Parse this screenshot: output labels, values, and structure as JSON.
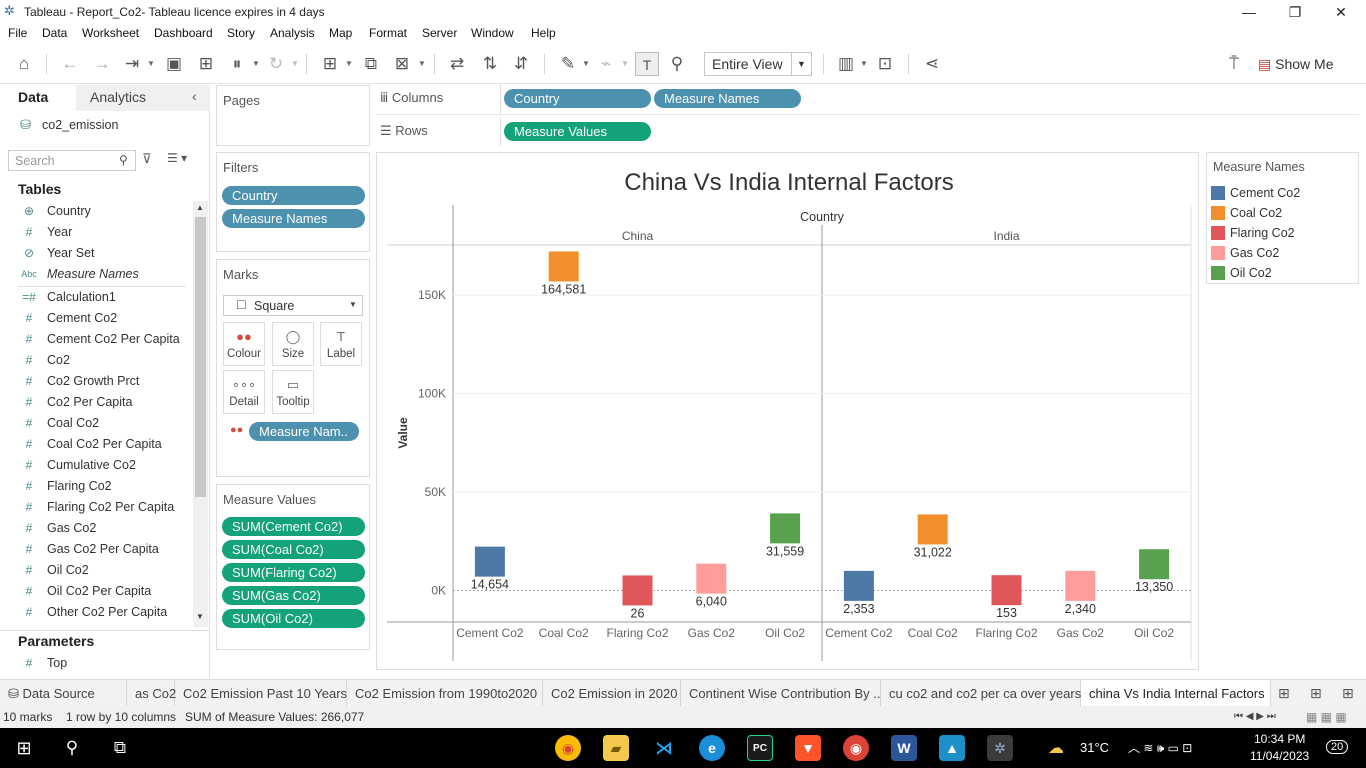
{
  "window": {
    "title": "Tableau - Report_Co2- Tableau licence expires in 4 days",
    "minimize": "—",
    "restore": "❐",
    "close": "✕"
  },
  "menu": [
    "File",
    "Data",
    "Worksheet",
    "Dashboard",
    "Story",
    "Analysis",
    "Map",
    "Format",
    "Server",
    "Window",
    "Help"
  ],
  "toolbar": {
    "fit": "Entire View",
    "show_me": "Show Me"
  },
  "left_pane": {
    "tabs": {
      "data": "Data",
      "analytics": "Analytics"
    },
    "datasource": "co2_emission",
    "search_placeholder": "Search",
    "tables_header": "Tables",
    "fields": [
      {
        "icon": "globe-icon",
        "glyph": "⊕",
        "name": "Country"
      },
      {
        "icon": "hash-icon",
        "glyph": "#",
        "name": "Year"
      },
      {
        "icon": "set-icon",
        "glyph": "⊘",
        "name": "Year Set"
      },
      {
        "icon": "abc-icon",
        "glyph": "Abc",
        "name": "Measure Names"
      },
      {
        "icon": "calc-icon",
        "glyph": "=#",
        "name": "Calculation1"
      },
      {
        "icon": "hash-icon",
        "glyph": "#",
        "name": "Cement Co2"
      },
      {
        "icon": "hash-icon",
        "glyph": "#",
        "name": "Cement Co2 Per Capita"
      },
      {
        "icon": "hash-icon",
        "glyph": "#",
        "name": "Co2"
      },
      {
        "icon": "hash-icon",
        "glyph": "#",
        "name": "Co2 Growth Prct"
      },
      {
        "icon": "hash-icon",
        "glyph": "#",
        "name": "Co2 Per Capita"
      },
      {
        "icon": "hash-icon",
        "glyph": "#",
        "name": "Coal Co2"
      },
      {
        "icon": "hash-icon",
        "glyph": "#",
        "name": "Coal Co2 Per Capita"
      },
      {
        "icon": "hash-icon",
        "glyph": "#",
        "name": "Cumulative Co2"
      },
      {
        "icon": "hash-icon",
        "glyph": "#",
        "name": "Flaring Co2"
      },
      {
        "icon": "hash-icon",
        "glyph": "#",
        "name": "Flaring Co2 Per Capita"
      },
      {
        "icon": "hash-icon",
        "glyph": "#",
        "name": "Gas Co2"
      },
      {
        "icon": "hash-icon",
        "glyph": "#",
        "name": "Gas Co2 Per Capita"
      },
      {
        "icon": "hash-icon",
        "glyph": "#",
        "name": "Oil Co2"
      },
      {
        "icon": "hash-icon",
        "glyph": "#",
        "name": "Oil Co2 Per Capita"
      },
      {
        "icon": "hash-icon",
        "glyph": "#",
        "name": "Other Co2 Per Capita"
      }
    ],
    "parameters_header": "Parameters",
    "parameters": [
      {
        "icon": "hash-icon",
        "glyph": "#",
        "name": "Top"
      }
    ]
  },
  "cards": {
    "pages": "Pages",
    "filters": {
      "title": "Filters",
      "pills": [
        "Country",
        "Measure Names"
      ]
    },
    "marks": {
      "title": "Marks",
      "type": "Square",
      "buttons": [
        {
          "label": "Colour",
          "glyph": "●●",
          "icon": "colour-icon"
        },
        {
          "label": "Size",
          "glyph": "◯",
          "icon": "size-icon"
        },
        {
          "label": "Label",
          "glyph": "T",
          "icon": "label-icon"
        },
        {
          "label": "Detail",
          "glyph": "∘∘∘",
          "icon": "detail-icon"
        },
        {
          "label": "Tooltip",
          "glyph": "▭",
          "icon": "tooltip-icon"
        }
      ],
      "colour_pill": "Measure Nam.."
    },
    "measure_values": {
      "title": "Measure Values",
      "pills": [
        "SUM(Cement Co2)",
        "SUM(Coal Co2)",
        "SUM(Flaring Co2)",
        "SUM(Gas Co2)",
        "SUM(Oil Co2)"
      ]
    }
  },
  "shelves": {
    "columns_label": "Columns",
    "columns": [
      "Country",
      "Measure Names"
    ],
    "rows_label": "Rows",
    "rows": [
      "Measure Values"
    ]
  },
  "legend": {
    "title": "Measure Names",
    "items": [
      {
        "name": "Cement Co2",
        "color": "#4e79a7"
      },
      {
        "name": "Coal Co2",
        "color": "#f28e2b"
      },
      {
        "name": "Flaring Co2",
        "color": "#e15759"
      },
      {
        "name": "Gas Co2",
        "color": "#ff9d9a"
      },
      {
        "name": "Oil Co2",
        "color": "#59a14f"
      }
    ]
  },
  "chart_data": {
    "type": "scatter",
    "title": "China Vs India Internal Factors",
    "column_header": "Country",
    "ylabel": "Value",
    "ylim": [
      -16000,
      176000
    ],
    "yticks": [
      0,
      50000,
      100000,
      150000
    ],
    "ytick_labels": [
      "0K",
      "50K",
      "100K",
      "150K"
    ],
    "grid": true,
    "categories": [
      "Cement Co2",
      "Coal Co2",
      "Flaring Co2",
      "Gas Co2",
      "Oil Co2"
    ],
    "series": [
      {
        "name": "China",
        "values": [
          14654,
          164581,
          26,
          6040,
          31559
        ],
        "labels": [
          "14,654",
          "164,581",
          "26",
          "6,040",
          "31,559"
        ]
      },
      {
        "name": "India",
        "values": [
          2353,
          31022,
          153,
          2340,
          13350
        ],
        "labels": [
          "2,353",
          "31,022",
          "153",
          "2,340",
          "13,350"
        ]
      }
    ]
  },
  "sheet_tabs": [
    {
      "label": "Data Source",
      "active": false
    },
    {
      "label": "as Co2",
      "active": false
    },
    {
      "label": "Co2 Emission Past 10 Years",
      "active": false
    },
    {
      "label": "Co2 Emission from 1990to2020",
      "active": false
    },
    {
      "label": "Co2 Emission in 2020",
      "active": false
    },
    {
      "label": "Continent Wise Contribution By ...",
      "active": false
    },
    {
      "label": "cu co2 and co2 per ca over years",
      "active": false
    },
    {
      "label": "china Vs India Internal Factors",
      "active": true
    }
  ],
  "status": {
    "marks": "10 marks",
    "rows_cols": "1 row by 10 columns",
    "sum": "SUM of Measure Values: 266,077"
  },
  "taskbar": {
    "weather": "31°C",
    "time": "10:34 PM",
    "date": "11/04/2023",
    "notifications": "20"
  }
}
